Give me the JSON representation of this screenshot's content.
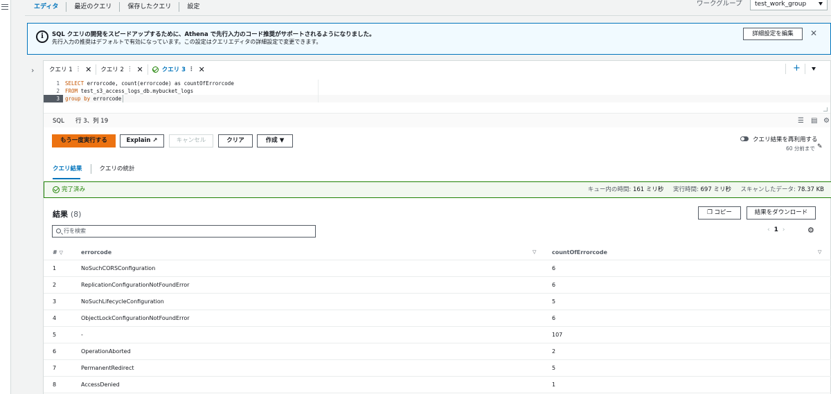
{
  "top_tabs": [
    {
      "label": "エディタ"
    },
    {
      "label": "最近のクエリ"
    },
    {
      "label": "保存したクエリ"
    },
    {
      "label": "設定"
    }
  ],
  "workgroup": {
    "label": "ワークグループ",
    "value": "test_work_group"
  },
  "banner": {
    "title": "SQL クエリの開発をスピードアップするために、Athena で先行入力のコード推奨がサポートされるようになりました。",
    "text": "先行入力の推奨はデフォルトで有効になっています。この設定はクエリエディタの詳細設定で変更できます。",
    "button": "詳細設定を編集"
  },
  "query_tabs": [
    {
      "label": "クエリ 1"
    },
    {
      "label": "クエリ 2"
    },
    {
      "label": "クエリ 3"
    }
  ],
  "editor": {
    "lines": [
      {
        "num": "1",
        "kw": "SELECT",
        "rest": " errorcode, count(errorcode) as countOfErrorcode"
      },
      {
        "num": "2",
        "kw": "FROM",
        "rest": " test_s3_access_logs_db.mybucket_logs"
      },
      {
        "num": "3",
        "kw": "group by",
        "rest": " errorcode"
      }
    ],
    "language": "SQL",
    "cursor": "行 3、列 19"
  },
  "actions": {
    "run_again": "もう一度実行する",
    "explain": "Explain",
    "cancel": "キャンセル",
    "clear": "クリア",
    "create": "作成",
    "reuse_label": "クエリ結果を再利用する",
    "reuse_sub": "60 分前まで"
  },
  "result_tabs": [
    {
      "label": "クエリ結果"
    },
    {
      "label": "クエリの統計"
    }
  ],
  "status": {
    "text": "完了済み",
    "queue_label": "キュー内の時間:",
    "queue_value": "161 ミリ秒",
    "exec_label": "実行時間:",
    "exec_value": "697 ミリ秒",
    "scan_label": "スキャンしたデータ:",
    "scan_value": "78.37 KB"
  },
  "results": {
    "title": "結果",
    "count": "(8)",
    "copy": "コピー",
    "download": "結果をダウンロード",
    "search_placeholder": "行を検索",
    "page": "1",
    "columns": [
      "#",
      "errorcode",
      "countOfErrorcode"
    ],
    "rows": [
      [
        "1",
        "NoSuchCORSConfiguration",
        "6"
      ],
      [
        "2",
        "ReplicationConfigurationNotFoundError",
        "6"
      ],
      [
        "3",
        "NoSuchLifecycleConfiguration",
        "5"
      ],
      [
        "4",
        "ObjectLockConfigurationNotFoundError",
        "6"
      ],
      [
        "5",
        "-",
        "107"
      ],
      [
        "6",
        "OperationAborted",
        "2"
      ],
      [
        "7",
        "PermanentRedirect",
        "5"
      ],
      [
        "8",
        "AccessDenied",
        "1"
      ]
    ]
  }
}
